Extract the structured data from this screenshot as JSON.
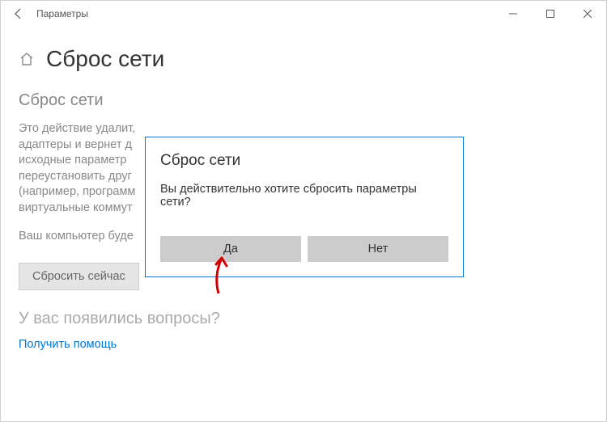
{
  "titlebar": {
    "app_name": "Параметры"
  },
  "header": {
    "page_title": "Сброс сети"
  },
  "main": {
    "subheading": "Сброс сети",
    "description_visible": "Это действие удалит,\nадаптеры и вернет д\nисходные параметр\nпереустановить друг\n(например, программ\nвиртуальные коммут",
    "restart_notice_visible": "Ваш компьютер буде",
    "reset_button": "Сбросить сейчас",
    "questions_heading": "У вас появились вопросы?",
    "help_link": "Получить помощь"
  },
  "dialog": {
    "title": "Сброс сети",
    "message": "Вы действительно хотите сбросить параметры сети?",
    "yes": "Да",
    "no": "Нет"
  }
}
